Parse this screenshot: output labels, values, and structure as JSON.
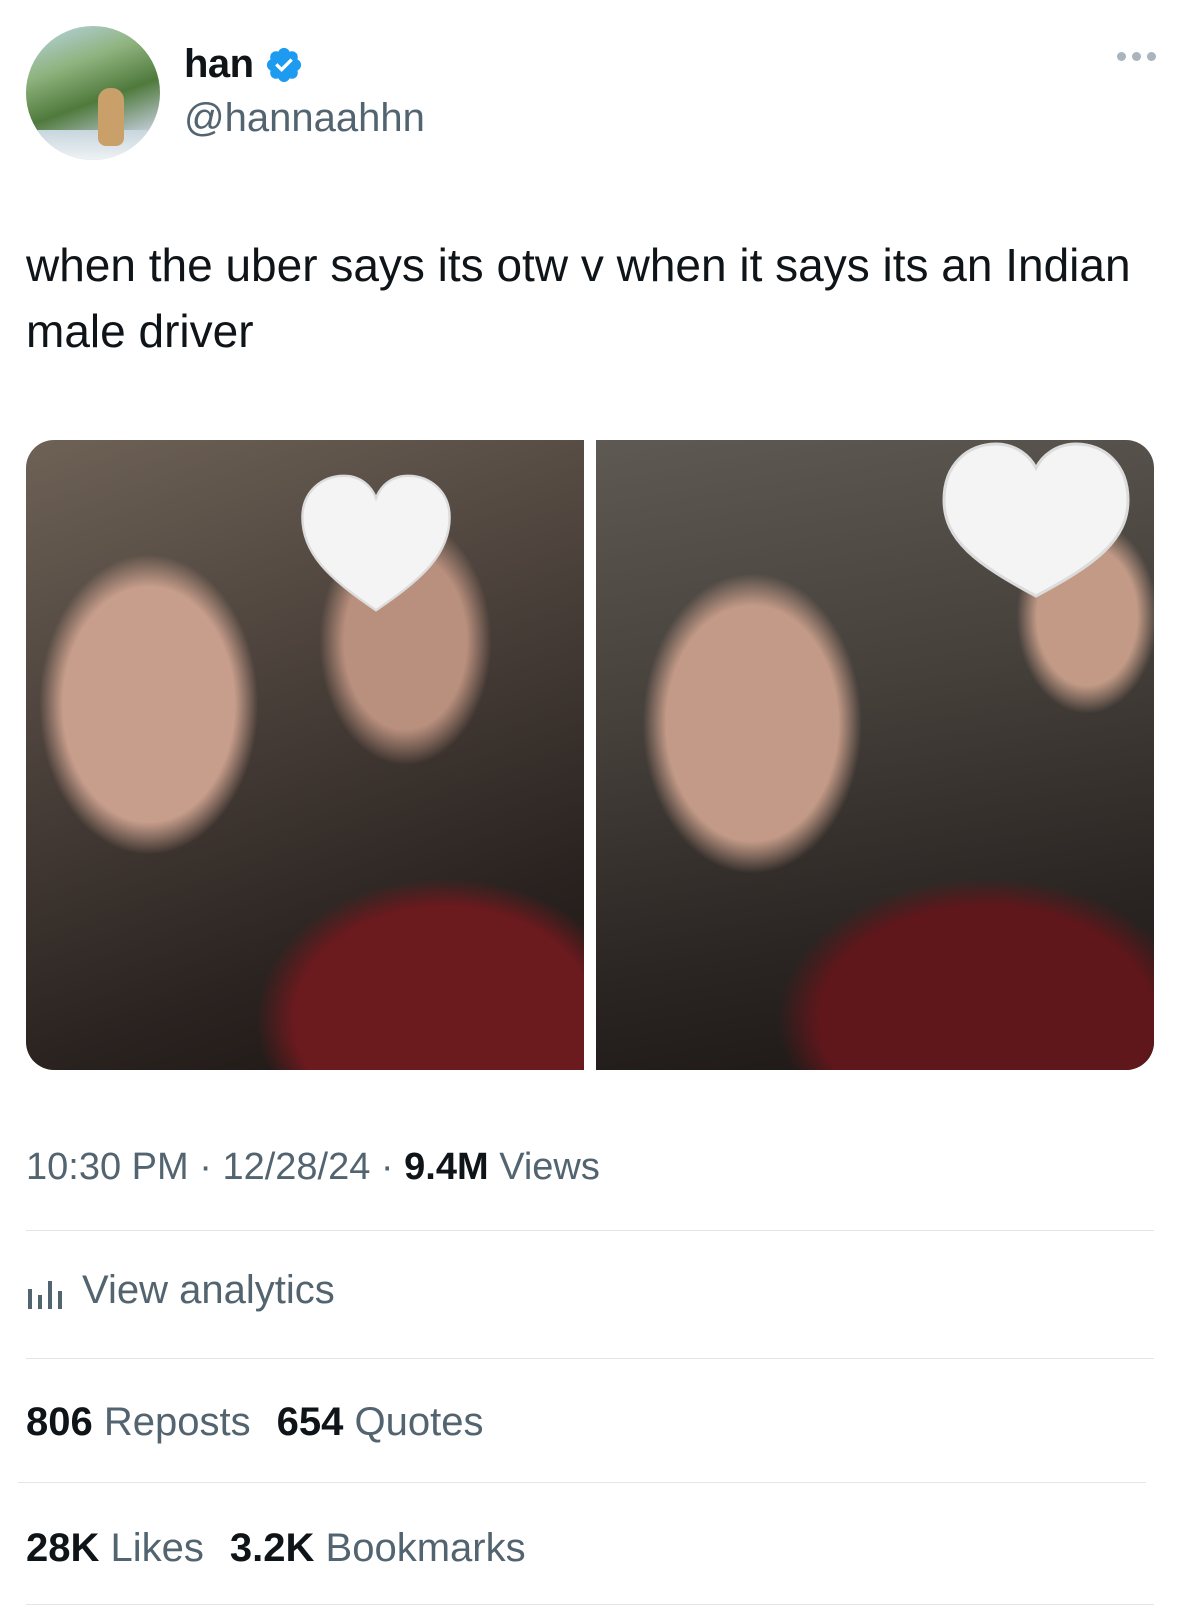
{
  "author": {
    "display_name": "han",
    "handle": "@hannaahhn",
    "verified": true
  },
  "icons": {
    "more": "more-horizontal-icon",
    "verified": "verified-badge-icon",
    "analytics": "bar-chart-icon"
  },
  "colors": {
    "verified_blue": "#1d9bf0",
    "secondary_text": "#536471",
    "primary_text": "#0f1419"
  },
  "tweet": {
    "text": "when the uber says its otw v when it says its an Indian male driver"
  },
  "meta": {
    "time": "10:30 PM",
    "separator": "·",
    "date": "12/28/24",
    "views_count": "9.4M",
    "views_label": "Views"
  },
  "analytics": {
    "label": "View analytics"
  },
  "stats": {
    "reposts_count": "806",
    "reposts_label": "Reposts",
    "quotes_count": "654",
    "quotes_label": "Quotes",
    "likes_count": "28K",
    "likes_label": "Likes",
    "bookmarks_count": "3.2K",
    "bookmarks_label": "Bookmarks"
  }
}
